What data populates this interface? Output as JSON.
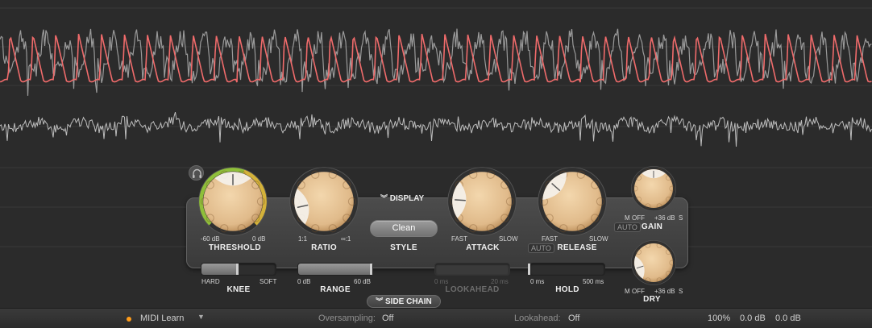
{
  "colors": {
    "input_wave": "#9a9a9a",
    "gain_wave": "#f06b6b",
    "knob_face": "#e0ba8a",
    "threshold_arc_green": "#8fbf3a",
    "threshold_arc_yellow": "#d4b23a",
    "midi_dot": "#ff9c1a"
  },
  "display_toggle": {
    "label": "DISPLAY",
    "icon": "double-chevron-down-icon"
  },
  "sidechain_toggle": {
    "label": "SIDE CHAIN",
    "icon": "double-chevron-down-icon"
  },
  "threshold": {
    "label": "THRESHOLD",
    "min": "-60 dB",
    "max": "0 dB",
    "value_fraction": 0.5
  },
  "ratio": {
    "label": "RATIO",
    "min": "1:1",
    "max": "∞:1",
    "value_fraction": 0.12
  },
  "style": {
    "label": "STYLE",
    "value": "Clean"
  },
  "attack": {
    "label": "ATTACK",
    "min": "FAST",
    "max": "SLOW",
    "value_fraction": 0.18
  },
  "release": {
    "label": "RELEASE",
    "auto": "AUTO",
    "min": "FAST",
    "max": "SLOW",
    "value_fraction": 0.32
  },
  "gain": {
    "label": "GAIN",
    "auto": "AUTO",
    "left": "M",
    "min": "OFF",
    "max": "+36 dB",
    "right": "S",
    "value_fraction": 0.5
  },
  "dry": {
    "label": "DRY",
    "left": "M",
    "min": "OFF",
    "max": "+36 dB",
    "right": "S",
    "value_fraction": 0.1
  },
  "knee": {
    "label": "KNEE",
    "min": "HARD",
    "max": "SOFT",
    "value_fraction": 0.5
  },
  "range": {
    "label": "RANGE",
    "min": "0 dB",
    "max": "60 dB",
    "value_fraction": 1.0
  },
  "lookahead": {
    "label": "LOOKAHEAD",
    "min": "0 ms",
    "max": "20 ms",
    "value_fraction": 0.0
  },
  "hold": {
    "label": "HOLD",
    "min": "0 ms",
    "max": "500 ms",
    "value_fraction": 0.0
  },
  "statusbar": {
    "midi_learn": "MIDI Learn",
    "oversampling_label": "Oversampling:",
    "oversampling_value": "Off",
    "lookahead_label": "Lookahead:",
    "lookahead_value": "Off",
    "zoom": "100%",
    "input_gain": "0.0 dB",
    "output_gain": "0.0 dB"
  }
}
